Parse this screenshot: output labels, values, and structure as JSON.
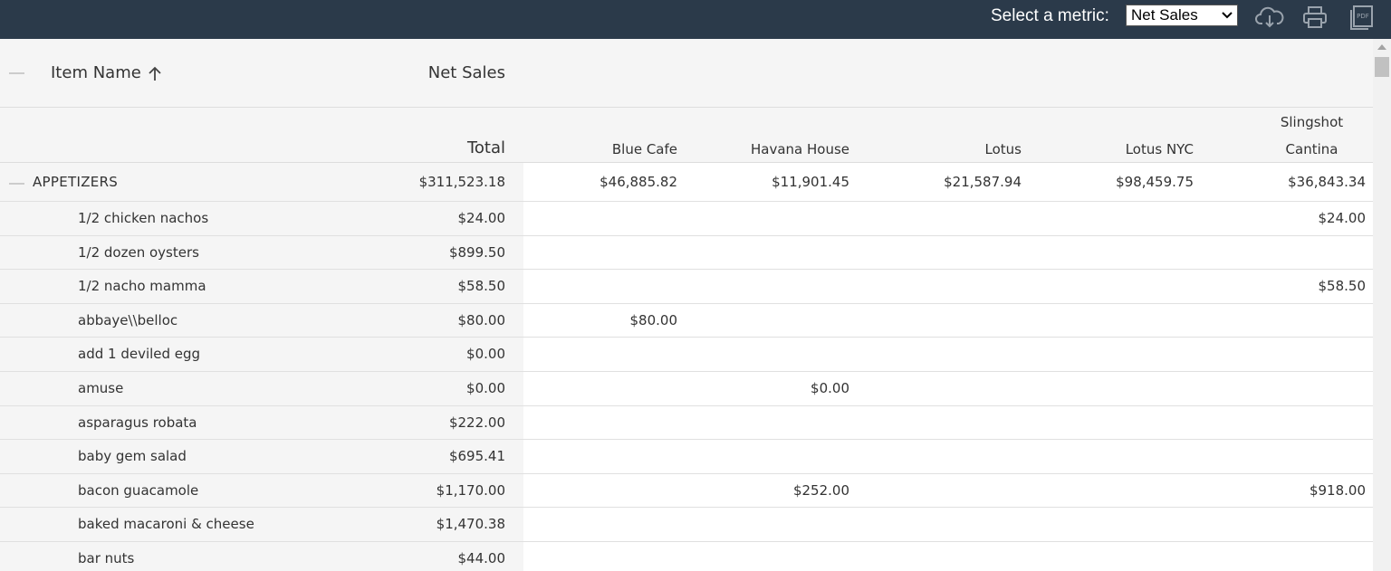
{
  "toolbar": {
    "metric_label": "Select a metric:",
    "metric_value": "Net Sales",
    "icons": [
      "cloud-download-icon",
      "print-icon",
      "pdf-icon"
    ]
  },
  "header": {
    "item_name": "Item Name",
    "metric": "Net Sales",
    "columns": [
      {
        "label": "Total"
      },
      {
        "label": "Blue Cafe"
      },
      {
        "label": "Havana House"
      },
      {
        "label": "Lotus"
      },
      {
        "label": "Lotus NYC"
      },
      {
        "label": "Slingshot",
        "label2": "Cantina"
      }
    ]
  },
  "groups": [
    {
      "name": "APPETIZERS",
      "values": [
        "$311,523.18",
        "$46,885.82",
        "$11,901.45",
        "$21,587.94",
        "$98,459.75",
        "$36,843.34"
      ]
    }
  ],
  "rows": [
    {
      "name": "1/2 chicken nachos",
      "values": [
        "$24.00",
        "",
        "",
        "",
        "",
        "$24.00"
      ]
    },
    {
      "name": "1/2 dozen oysters",
      "values": [
        "$899.50",
        "",
        "",
        "",
        "",
        ""
      ]
    },
    {
      "name": "1/2 nacho mamma",
      "values": [
        "$58.50",
        "",
        "",
        "",
        "",
        "$58.50"
      ]
    },
    {
      "name": "abbaye\\\\belloc",
      "values": [
        "$80.00",
        "$80.00",
        "",
        "",
        "",
        ""
      ]
    },
    {
      "name": "add 1 deviled egg",
      "values": [
        "$0.00",
        "",
        "",
        "",
        "",
        ""
      ]
    },
    {
      "name": "amuse",
      "values": [
        "$0.00",
        "",
        "$0.00",
        "",
        "",
        ""
      ]
    },
    {
      "name": "asparagus robata",
      "values": [
        "$222.00",
        "",
        "",
        "",
        "",
        ""
      ]
    },
    {
      "name": "baby gem salad",
      "values": [
        "$695.41",
        "",
        "",
        "",
        "",
        ""
      ]
    },
    {
      "name": "bacon guacamole",
      "values": [
        "$1,170.00",
        "",
        "$252.00",
        "",
        "",
        "$918.00"
      ]
    },
    {
      "name": "baked macaroni & cheese",
      "values": [
        "$1,470.38",
        "",
        "",
        "",
        "",
        ""
      ]
    },
    {
      "name": "bar nuts",
      "values": [
        "$44.00",
        "",
        "",
        "",
        "",
        ""
      ]
    }
  ]
}
